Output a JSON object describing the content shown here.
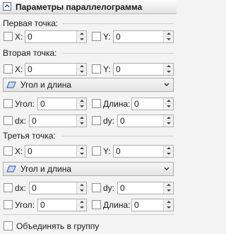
{
  "panel": {
    "title": "Параметры параллелограмма"
  },
  "point1": {
    "heading": "Первая точка:",
    "x": {
      "label": "X:",
      "value": "0"
    },
    "y": {
      "label": "Y:",
      "value": "0"
    }
  },
  "point2": {
    "heading": "Вторая точка:",
    "x": {
      "label": "X:",
      "value": "0"
    },
    "y": {
      "label": "Y:",
      "value": "0"
    },
    "mode": "Угол и длина",
    "angle": {
      "label": "Угол:",
      "value": "0"
    },
    "length": {
      "label": "Длина:",
      "value": "0"
    },
    "dx": {
      "label": "dx:",
      "value": "0"
    },
    "dy": {
      "label": "dy:",
      "value": "0"
    }
  },
  "point3": {
    "heading": "Третья точка:",
    "x": {
      "label": "X:",
      "value": "0"
    },
    "y": {
      "label": "Y:",
      "value": "0"
    },
    "mode": "Угол и длина",
    "dx": {
      "label": "dx:",
      "value": "0"
    },
    "dy": {
      "label": "dy:",
      "value": "0"
    },
    "angle": {
      "label": "Угол:",
      "value": "0"
    },
    "length": {
      "label": "Длина:",
      "value": "0"
    }
  },
  "group": {
    "label": "Объединять в группу"
  },
  "colors": {
    "accent": "#3a6ea5",
    "background": "#f3f3f3"
  },
  "icons": {
    "collapse": "collapse-icon",
    "mode": "parallelogram-icon",
    "dropdown": "chevron-down-icon"
  }
}
